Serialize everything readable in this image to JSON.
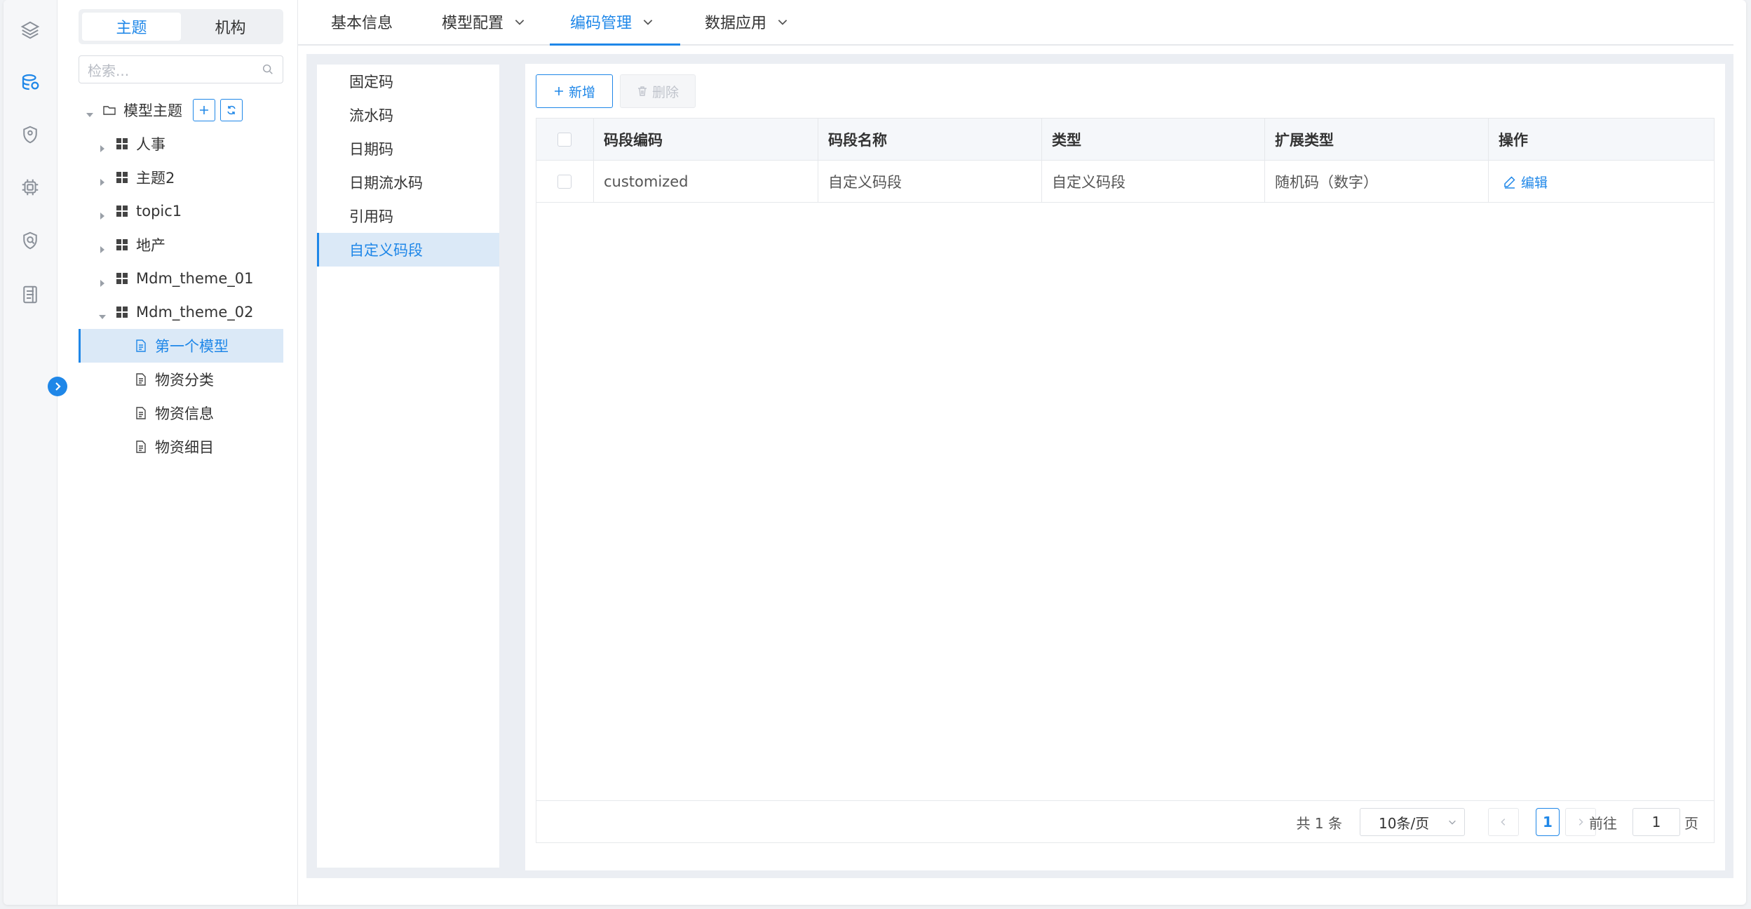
{
  "sidebar_tabs": {
    "topic": "主题",
    "org": "机构"
  },
  "search": {
    "placeholder": "检索..."
  },
  "tree": {
    "root": "模型主题",
    "nodes": [
      "人事",
      "主题2",
      "topic1",
      "地产",
      "Mdm_theme_01",
      "Mdm_theme_02"
    ],
    "children": [
      "第一个模型",
      "物资分类",
      "物资信息",
      "物资细目"
    ]
  },
  "tabs": [
    {
      "label": "基本信息"
    },
    {
      "label": "模型配置"
    },
    {
      "label": "编码管理"
    },
    {
      "label": "数据应用"
    }
  ],
  "code_menu": [
    "固定码",
    "流水码",
    "日期码",
    "日期流水码",
    "引用码",
    "自定义码段"
  ],
  "toolbar": {
    "add_label": "新增",
    "delete_label": "删除"
  },
  "table": {
    "headers": [
      "码段编码",
      "码段名称",
      "类型",
      "扩展类型",
      "操作"
    ],
    "rows": [
      {
        "code": "customized",
        "name": "自定义码段",
        "type": "自定义码段",
        "ext_type": "随机码（数字）",
        "action": "编辑"
      }
    ]
  },
  "pagination": {
    "total": "共 1 条",
    "page_size": "10条/页",
    "current_page": "1",
    "goto_label": "前往",
    "goto_value": "1",
    "page_suffix": "页"
  },
  "colors": {
    "accent": "#1f87e8",
    "selected_bg": "#dbe9f7",
    "content_bg": "#ebeef3"
  },
  "icons": [
    "layers-icon",
    "database-icon",
    "location-shield-icon",
    "chip-icon",
    "security-shield-icon",
    "document-list-icon"
  ]
}
